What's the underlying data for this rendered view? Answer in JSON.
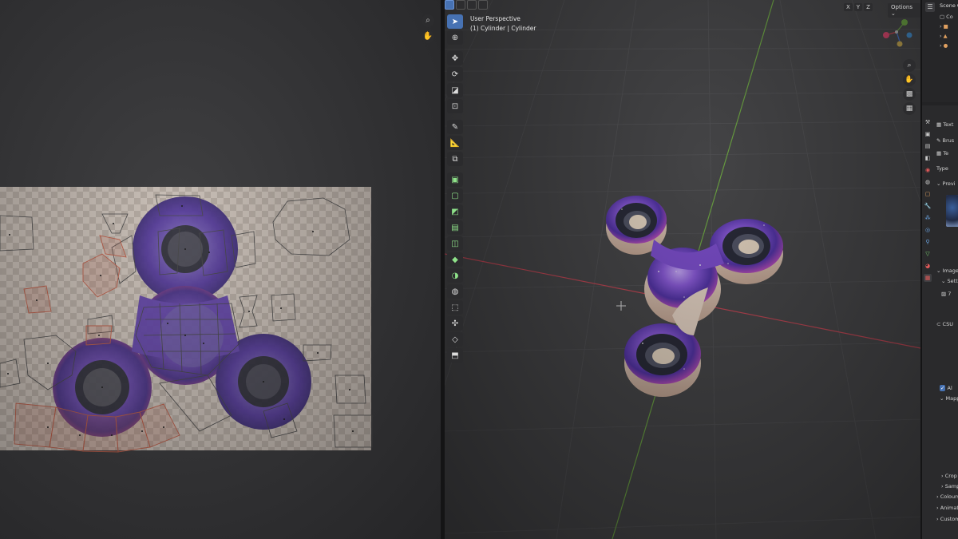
{
  "viewport": {
    "perspective_label": "User Perspective",
    "object_label": "(1) Cylinder | Cylinder",
    "axis_buttons": [
      "X",
      "Y",
      "Z"
    ],
    "options_label": "Options"
  },
  "sidebar": {
    "outliner_title": "Scene C",
    "outliner_row_label": "Co",
    "properties_rows": [
      {
        "key": "texture",
        "label": "Text"
      },
      {
        "key": "brush",
        "label": "Brus"
      },
      {
        "key": "texture2",
        "label": "Te"
      },
      {
        "key": "type",
        "label": "Type"
      },
      {
        "key": "preview",
        "label": "Previ"
      },
      {
        "key": "image",
        "label": "Image"
      },
      {
        "key": "settings",
        "label": "Setti"
      },
      {
        "key": "image_value",
        "label": "7"
      },
      {
        "key": "image_name",
        "label": "CSU"
      },
      {
        "key": "alpha",
        "label": "Al"
      },
      {
        "key": "mapping",
        "label": "Mapp"
      },
      {
        "key": "crop",
        "label": "Crop"
      },
      {
        "key": "sampling",
        "label": "Sampl"
      },
      {
        "key": "colours",
        "label": "Colours"
      },
      {
        "key": "animation",
        "label": "Animati"
      },
      {
        "key": "custom_props",
        "label": "Custom P"
      }
    ]
  },
  "colors": {
    "active_blue": "#4772b3",
    "x_axis": "#c8404f",
    "y_axis": "#6aa83c",
    "uv_selected": "#e0664a",
    "galaxy_purple": "#7a4fd0"
  }
}
